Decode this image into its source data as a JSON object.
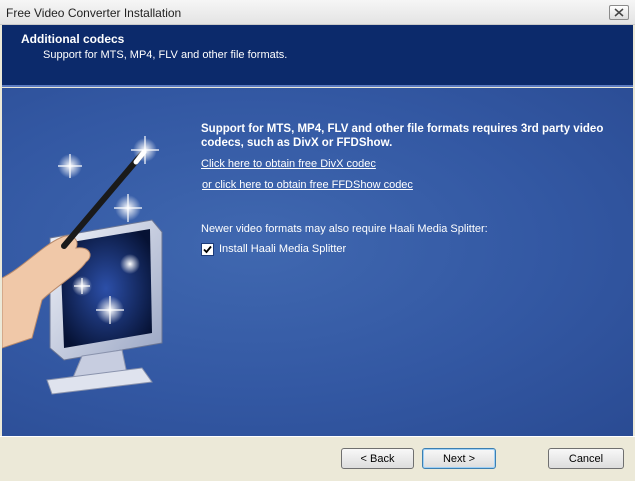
{
  "window": {
    "title": "Free Video Converter Installation"
  },
  "header": {
    "title": "Additional codecs",
    "subtitle": "Support for MTS, MP4, FLV and other file formats."
  },
  "main": {
    "description": "Support for MTS, MP4, FLV and other file formats requires 3rd party video codecs, such as DivX or FFDShow.",
    "link_divx": "Click here to obtain free DivX codec",
    "link_ffdshow": "or click here to obtain free FFDShow codec",
    "splitter_note": "Newer video formats may also require Haali Media Splitter:",
    "checkbox_label": "Install Haali Media Splitter",
    "checkbox_checked": true
  },
  "buttons": {
    "back": "< Back",
    "next": "Next >",
    "cancel": "Cancel"
  },
  "colors": {
    "header_bg": "#0c2a6b",
    "body_bg": "#3358a3",
    "dialog_bg": "#ece9d8"
  },
  "icons": [
    "close-icon",
    "wizard-illustration",
    "check-icon"
  ]
}
